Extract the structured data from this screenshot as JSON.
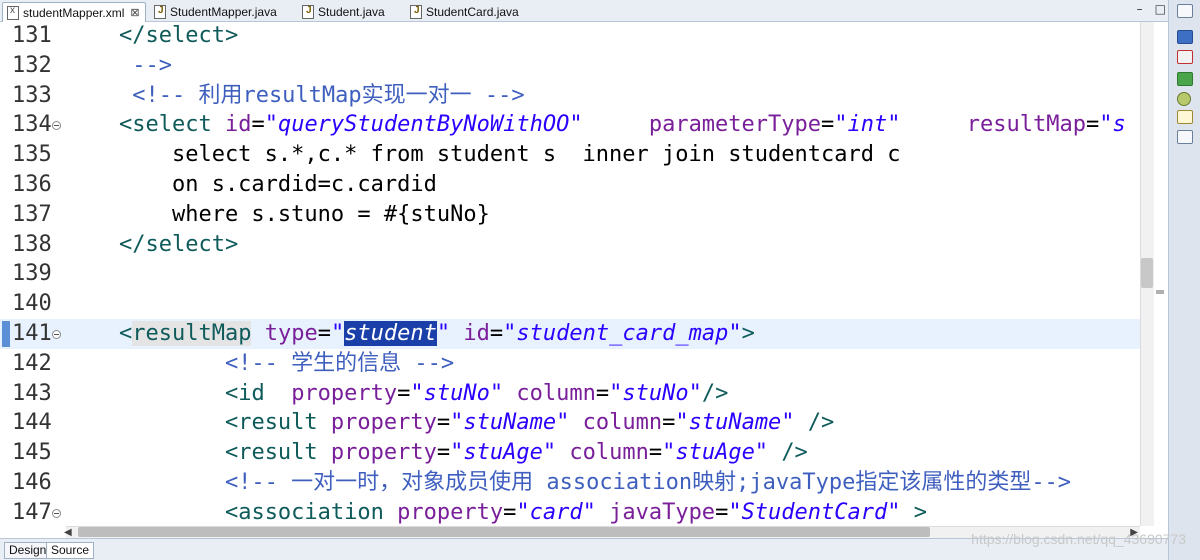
{
  "tabs": [
    {
      "label": "studentMapper.xml",
      "kind": "xml",
      "active": true,
      "close": "⊠"
    },
    {
      "label": "StudentMapper.java",
      "kind": "java",
      "active": false
    },
    {
      "label": "Student.java",
      "kind": "java",
      "active": false
    },
    {
      "label": "StudentCard.java",
      "kind": "java",
      "active": false
    }
  ],
  "window_buttons": {
    "minimize": "–",
    "maximize": "□"
  },
  "editor": {
    "lines": [
      {
        "num": "131",
        "segments": [
          {
            "t": "p",
            "s": "    "
          },
          {
            "t": "t",
            "s": "</select>"
          }
        ]
      },
      {
        "num": "132",
        "segments": [
          {
            "t": "c",
            "s": "     -->"
          }
        ]
      },
      {
        "num": "133",
        "segments": [
          {
            "t": "c",
            "s": "     <!-- 利用resultMap实现一对一 -->"
          }
        ]
      },
      {
        "num": "134",
        "fold": true,
        "segments": [
          {
            "t": "p",
            "s": "    "
          },
          {
            "t": "t",
            "s": "<select "
          },
          {
            "t": "a",
            "s": "id"
          },
          {
            "t": "p",
            "s": "="
          },
          {
            "t": "v",
            "s": "\"queryStudentByNoWithOO\""
          },
          {
            "t": "p",
            "s": "     "
          },
          {
            "t": "a",
            "s": "parameterType"
          },
          {
            "t": "p",
            "s": "="
          },
          {
            "t": "v",
            "s": "\"int\""
          },
          {
            "t": "p",
            "s": "     "
          },
          {
            "t": "a",
            "s": "resultMap"
          },
          {
            "t": "p",
            "s": "="
          },
          {
            "t": "v",
            "s": "\"s"
          }
        ]
      },
      {
        "num": "135",
        "segments": [
          {
            "t": "p",
            "s": "        select s.*,c.* from student s  inner join studentcard c"
          }
        ]
      },
      {
        "num": "136",
        "segments": [
          {
            "t": "p",
            "s": "        on s.cardid=c.cardid"
          }
        ]
      },
      {
        "num": "137",
        "segments": [
          {
            "t": "p",
            "s": "        where s.stuno = #{stuNo}"
          }
        ]
      },
      {
        "num": "138",
        "segments": [
          {
            "t": "p",
            "s": "    "
          },
          {
            "t": "t",
            "s": "</select>"
          }
        ]
      },
      {
        "num": "139",
        "segments": []
      },
      {
        "num": "140",
        "segments": []
      },
      {
        "num": "141",
        "fold": true,
        "current": true,
        "segments": [
          {
            "t": "p",
            "s": "    "
          },
          {
            "t": "t",
            "s": "<"
          },
          {
            "t": "t hl",
            "s": "resultMap"
          },
          {
            "t": "p",
            "s": " "
          },
          {
            "t": "a",
            "s": "type"
          },
          {
            "t": "p",
            "s": "="
          },
          {
            "t": "v",
            "s": "\""
          },
          {
            "t": "sel",
            "s": "student"
          },
          {
            "t": "v",
            "s": "\""
          },
          {
            "t": "p",
            "s": " "
          },
          {
            "t": "a",
            "s": "id"
          },
          {
            "t": "p",
            "s": "="
          },
          {
            "t": "v",
            "s": "\"student_card_map\""
          },
          {
            "t": "t",
            "s": ">"
          }
        ]
      },
      {
        "num": "142",
        "segments": [
          {
            "t": "c",
            "s": "            <!-- 学生的信息 -->"
          }
        ]
      },
      {
        "num": "143",
        "segments": [
          {
            "t": "p",
            "s": "            "
          },
          {
            "t": "t",
            "s": "<id  "
          },
          {
            "t": "a",
            "s": "property"
          },
          {
            "t": "p",
            "s": "="
          },
          {
            "t": "v",
            "s": "\"stuNo\""
          },
          {
            "t": "p",
            "s": " "
          },
          {
            "t": "a",
            "s": "column"
          },
          {
            "t": "p",
            "s": "="
          },
          {
            "t": "v",
            "s": "\"stuNo\""
          },
          {
            "t": "t",
            "s": "/>"
          }
        ]
      },
      {
        "num": "144",
        "segments": [
          {
            "t": "p",
            "s": "            "
          },
          {
            "t": "t",
            "s": "<result "
          },
          {
            "t": "a",
            "s": "property"
          },
          {
            "t": "p",
            "s": "="
          },
          {
            "t": "v",
            "s": "\"stuName\""
          },
          {
            "t": "p",
            "s": " "
          },
          {
            "t": "a",
            "s": "column"
          },
          {
            "t": "p",
            "s": "="
          },
          {
            "t": "v",
            "s": "\"stuName\""
          },
          {
            "t": "p",
            "s": " "
          },
          {
            "t": "t",
            "s": "/>"
          }
        ]
      },
      {
        "num": "145",
        "segments": [
          {
            "t": "p",
            "s": "            "
          },
          {
            "t": "t",
            "s": "<result "
          },
          {
            "t": "a",
            "s": "property"
          },
          {
            "t": "p",
            "s": "="
          },
          {
            "t": "v",
            "s": "\"stuAge\""
          },
          {
            "t": "p",
            "s": " "
          },
          {
            "t": "a",
            "s": "column"
          },
          {
            "t": "p",
            "s": "="
          },
          {
            "t": "v",
            "s": "\"stuAge\""
          },
          {
            "t": "p",
            "s": " "
          },
          {
            "t": "t",
            "s": "/>"
          }
        ]
      },
      {
        "num": "146",
        "segments": [
          {
            "t": "c",
            "s": "            <!-- 一对一时，对象成员使用 association映射;javaType指定该属性的类型-->"
          }
        ]
      },
      {
        "num": "147",
        "fold": true,
        "segments": [
          {
            "t": "p",
            "s": "            "
          },
          {
            "t": "t",
            "s": "<association "
          },
          {
            "t": "a",
            "s": "property"
          },
          {
            "t": "p",
            "s": "="
          },
          {
            "t": "v",
            "s": "\"card\""
          },
          {
            "t": "p",
            "s": " "
          },
          {
            "t": "a",
            "s": "javaType"
          },
          {
            "t": "p",
            "s": "="
          },
          {
            "t": "v",
            "s": "\"StudentCard\""
          },
          {
            "t": "p",
            "s": " "
          },
          {
            "t": "t",
            "s": ">"
          }
        ]
      }
    ]
  },
  "bottom_tabs": [
    {
      "label": "Design",
      "active": false
    },
    {
      "label": "Source",
      "active": true
    }
  ],
  "scroll_arrows": {
    "left": "◀",
    "right": "▶"
  },
  "watermark": "https://blog.csdn.net/qq_43690773",
  "right_toolbar_icons": [
    "restore-icon",
    "outline-icon",
    "problems-icon",
    "outline-tree-icon",
    "gear-icon",
    "documentation-icon",
    "properties-icon"
  ]
}
